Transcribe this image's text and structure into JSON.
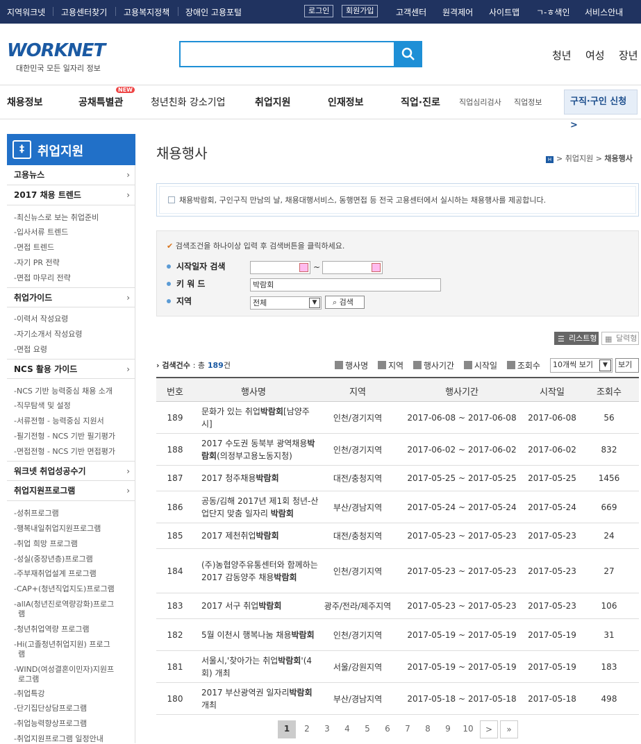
{
  "topbar": {
    "left": [
      "지역워크넷",
      "고용센터찾기",
      "고용복지정책",
      "장애인 고용포털"
    ],
    "login": "로그인",
    "join": "회원가입",
    "right": [
      "고객센터",
      "원격제어",
      "사이트맵",
      "ㄱ-ㅎ색인",
      "서비스안내"
    ]
  },
  "logo": {
    "text": "WORKNET",
    "sub": "대한민국 모든 일자리 정보"
  },
  "search": {
    "placeholder": ""
  },
  "toplinks": [
    "청년",
    "여성",
    "장년"
  ],
  "nav": {
    "items": [
      "채용정보",
      "공채특별관",
      "청년친화 강소기업",
      "취업지원",
      "인재정보",
      "직업·진로"
    ],
    "new": "NEW",
    "small": [
      "직업심리검사",
      "직업정보"
    ],
    "apply": "구직·구인 신청 >"
  },
  "side": {
    "title": "취업지원",
    "groups": {
      "g1": "고용뉴스",
      "g2": "2017 채용 트렌드",
      "g2s": [
        "-최신뉴스로 보는 취업준비",
        "-입사서류 트렌드",
        "-면접 트렌드",
        "-자기 PR 전략",
        "-면접 마무리 전략"
      ],
      "g3": "취업가이드",
      "g3s": [
        "-이력서 작성요령",
        "-자기소개서 작성요령",
        "-면접 요령"
      ],
      "g4": "NCS 활용 가이드",
      "g4s": [
        "-NCS 기반 능력중심 채용 소개",
        "-직무탐색 및 설정",
        "-서류전형 - 능력중심 지원서",
        "-필기전형 - NCS 기반 필기평가",
        "-면접전형 - NCS 기반 면접평가"
      ],
      "g5": "워크넷 취업성공수기",
      "g6": "취업지원프로그램",
      "g6s": [
        "-성취프로그램",
        "-행복내일취업지원프로그램",
        "-취업 희망 프로그램",
        "-성실(중장년층)프로그램",
        "-주부재취업설계 프로그램",
        "-CAP+(청년직업지도)프로그램",
        "-allA(청년진로역량강화)프로그",
        "램",
        "-청년취업역량 프로그램",
        "-Hi(고졸청년취업지원) 프로그",
        "램",
        "-WIND(여성결혼이민자)지원프",
        "로그램",
        "-취업특강",
        "-단기집단상담프로그램",
        "-취업능력향상프로그램",
        "-취업지원프로그램 일정안내"
      ]
    }
  },
  "page": {
    "title": "채용행사",
    "crumb_mid": "취업지원",
    "crumb_last": "채용행사",
    "info": "채용박람회, 구인구직 만남의 날, 채용대행서비스, 동행면접 등 전국 고용센터에서 실시하는 채용행사를 제공합니다."
  },
  "form": {
    "guide": "검색조건을 하나이상 입력 후 검색버튼을 클릭하세요.",
    "start_label": "시작일자 검색",
    "keyword_label": "키 워 드",
    "region_label": "지역",
    "keyword": "박람회",
    "region": "전체",
    "tilde": "~",
    "search_btn": "검색"
  },
  "view": {
    "list": "리스트형",
    "calendar": "달력형"
  },
  "count": {
    "label": "검색건수",
    "pre": ": 총",
    "num": "189",
    "unit": "건"
  },
  "opts": [
    "행사명",
    "지역",
    "행사기간",
    "시작일",
    "조회수"
  ],
  "perpage": "10개씩 보기",
  "perpage_btn": "보기",
  "table": {
    "headers": [
      "번호",
      "행사명",
      "지역",
      "행사기간",
      "시작일",
      "조회수"
    ],
    "rows": [
      {
        "no": "189",
        "name": "문화가 있는 취업박람회[남양주시]",
        "region": "인천/경기지역",
        "period": "2017-06-08 ~ 2017-06-08",
        "start": "2017-06-08",
        "views": "56"
      },
      {
        "no": "188",
        "name": "2017 수도권 동북부 광역채용박람회(의정부고용노동지청)",
        "region": "인천/경기지역",
        "period": "2017-06-02 ~ 2017-06-02",
        "start": "2017-06-02",
        "views": "832"
      },
      {
        "no": "187",
        "name": "2017 청주채용박람회",
        "region": "대전/충청지역",
        "period": "2017-05-25 ~ 2017-05-25",
        "start": "2017-05-25",
        "views": "1456"
      },
      {
        "no": "186",
        "name": "공동/김해 2017년 제1회 청년-산업단지 맞춤 일자리 박람회",
        "region": "부산/경남지역",
        "period": "2017-05-24 ~ 2017-05-24",
        "start": "2017-05-24",
        "views": "669"
      },
      {
        "no": "185",
        "name": "2017 제천취업박람회",
        "region": "대전/충청지역",
        "period": "2017-05-23 ~ 2017-05-23",
        "start": "2017-05-23",
        "views": "24"
      },
      {
        "no": "184",
        "name": "(주)농협양주유통센터와 함께하는 2017 감동양주 채용박람회",
        "region": "인천/경기지역",
        "period": "2017-05-23 ~ 2017-05-23",
        "start": "2017-05-23",
        "views": "27"
      },
      {
        "no": "183",
        "name": "2017 서구 취업박람회",
        "region": "광주/전라/제주지역",
        "period": "2017-05-23 ~ 2017-05-23",
        "start": "2017-05-23",
        "views": "106"
      },
      {
        "no": "182",
        "name": "5월 이천시 행복나눔 채용박람회",
        "region": "인천/경기지역",
        "period": "2017-05-19 ~ 2017-05-19",
        "start": "2017-05-19",
        "views": "31"
      },
      {
        "no": "181",
        "name": "서울시,'찾아가는 취업박람회'(4회) 개최",
        "region": "서울/강원지역",
        "period": "2017-05-19 ~ 2017-05-19",
        "start": "2017-05-19",
        "views": "183"
      },
      {
        "no": "180",
        "name": "2017 부산광역권 일자리박람회 개최",
        "region": "부산/경남지역",
        "period": "2017-05-18 ~ 2017-05-18",
        "start": "2017-05-18",
        "views": "498"
      }
    ]
  },
  "pager": {
    "pages": [
      "1",
      "2",
      "3",
      "4",
      "5",
      "6",
      "7",
      "8",
      "9",
      "10"
    ],
    "next": ">",
    "last": "»"
  }
}
